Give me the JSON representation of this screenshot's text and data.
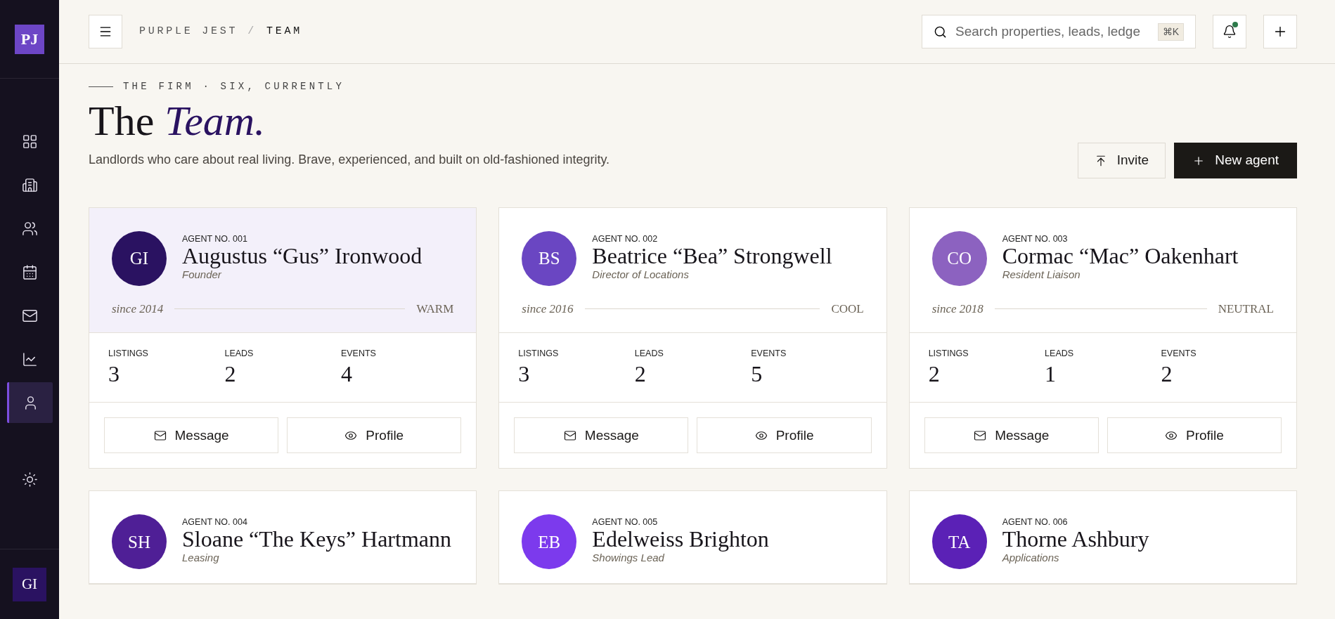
{
  "sidebar": {
    "logo": "PJ",
    "nav": [
      {
        "selected": false
      },
      {
        "selected": false
      },
      {
        "selected": false
      },
      {
        "selected": false
      },
      {
        "selected": false
      },
      {
        "selected": false
      },
      {
        "selected": true
      }
    ],
    "user_initials": "GI"
  },
  "header": {
    "breadcrumb": {
      "parent": "PURPLE JEST",
      "separator": "/",
      "current": "TEAM"
    },
    "search": {
      "placeholder": "Search properties, leads, ledge",
      "shortcut": "⌘K"
    },
    "notifications": {
      "unread": true
    }
  },
  "hero": {
    "eyebrow": "THE FIRM · SIX, CURRENTLY",
    "title": "The",
    "title_accent": "Team.",
    "subtitle": "Landlords who care about real living. Brave, experienced, and built on old-fashioned integrity.",
    "actions": [
      {
        "kind": "secondary",
        "label": "Invite"
      },
      {
        "kind": "primary",
        "label": "New agent"
      }
    ]
  },
  "agents": [
    {
      "selected": true,
      "initials": "GI",
      "color": "#2a1261",
      "number": "AGENT NO. 001",
      "name": "Augustus “Gus” Ironwood",
      "role": "Founder",
      "since": "since 2014",
      "temperament": "WARM",
      "stats": [
        {
          "label": "LISTINGS",
          "value": "3"
        },
        {
          "label": "LEADS",
          "value": "2"
        },
        {
          "label": "EVENTS",
          "value": "4"
        }
      ],
      "buttons": [
        {
          "kind": "message",
          "label": "Message"
        },
        {
          "kind": "profile",
          "label": "Profile"
        }
      ]
    },
    {
      "selected": false,
      "initials": "BS",
      "color": "#6a46c2",
      "number": "AGENT NO. 002",
      "name": "Beatrice “Bea” Strongwell",
      "role": "Director of Locations",
      "since": "since 2016",
      "temperament": "COOL",
      "stats": [
        {
          "label": "LISTINGS",
          "value": "3"
        },
        {
          "label": "LEADS",
          "value": "2"
        },
        {
          "label": "EVENTS",
          "value": "5"
        }
      ],
      "buttons": [
        {
          "kind": "message",
          "label": "Message"
        },
        {
          "kind": "profile",
          "label": "Profile"
        }
      ]
    },
    {
      "selected": false,
      "initials": "CO",
      "color": "#8c62c0",
      "number": "AGENT NO. 003",
      "name": "Cormac “Mac” Oakenhart",
      "role": "Resident Liaison",
      "since": "since 2018",
      "temperament": "NEUTRAL",
      "stats": [
        {
          "label": "LISTINGS",
          "value": "2"
        },
        {
          "label": "LEADS",
          "value": "1"
        },
        {
          "label": "EVENTS",
          "value": "2"
        }
      ],
      "buttons": [
        {
          "kind": "message",
          "label": "Message"
        },
        {
          "kind": "profile",
          "label": "Profile"
        }
      ]
    },
    {
      "selected": false,
      "initials": "SH",
      "color": "#4f1f96",
      "number": "AGENT NO. 004",
      "name": "Sloane “The Keys” Hartmann",
      "role": "Leasing"
    },
    {
      "selected": false,
      "initials": "EB",
      "color": "#7c3aed",
      "number": "AGENT NO. 005",
      "name": "Edelweiss Brighton",
      "role": "Showings Lead"
    },
    {
      "selected": false,
      "initials": "TA",
      "color": "#5b21b6",
      "number": "AGENT NO. 006",
      "name": "Thorne Ashbury",
      "role": "Applications"
    }
  ]
}
